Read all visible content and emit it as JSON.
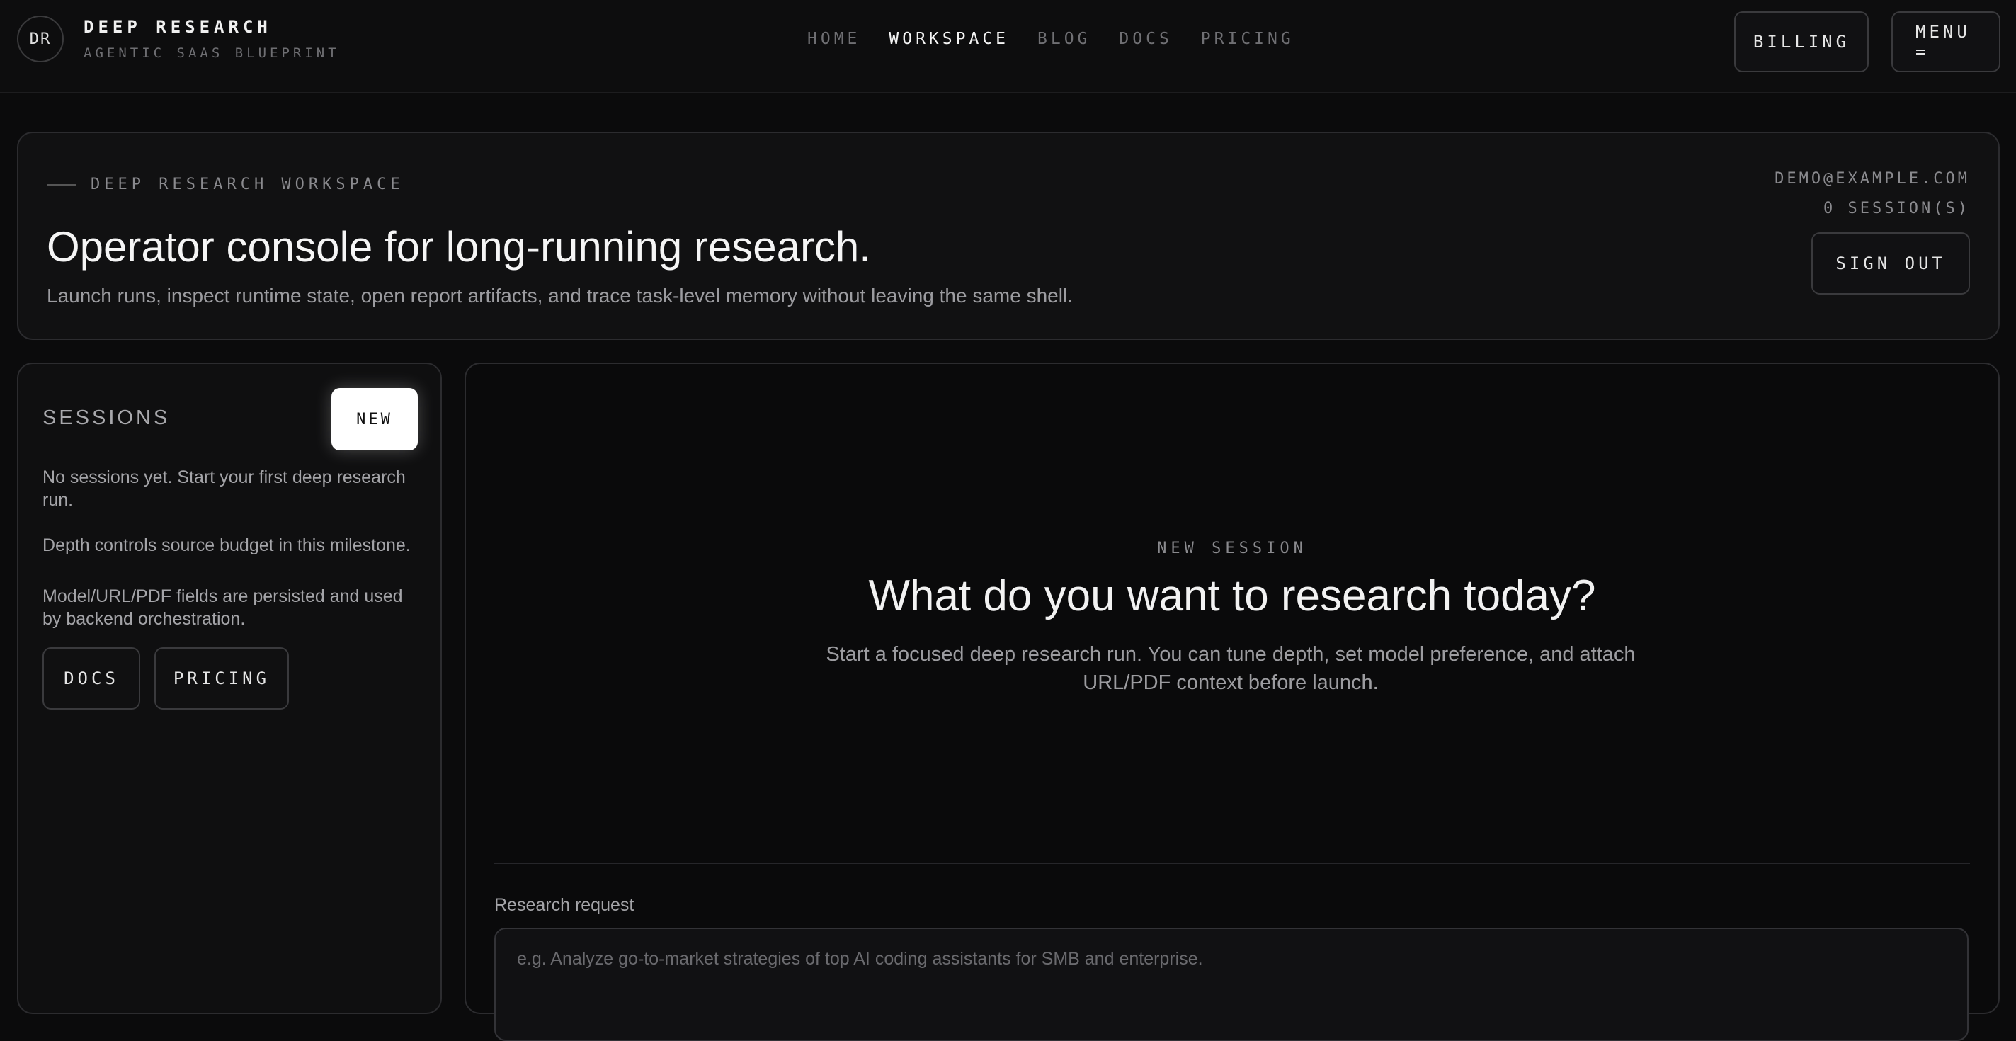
{
  "brand": {
    "logo": "DR",
    "title": "DEEP RESEARCH",
    "subtitle": "AGENTIC SAAS BLUEPRINT"
  },
  "nav": {
    "items": [
      {
        "label": "HOME",
        "active": false
      },
      {
        "label": "WORKSPACE",
        "active": true
      },
      {
        "label": "BLOG",
        "active": false
      },
      {
        "label": "DOCS",
        "active": false
      },
      {
        "label": "PRICING",
        "active": false
      }
    ]
  },
  "top_actions": {
    "billing": "BILLING",
    "menu": "MENU ="
  },
  "hero": {
    "eyebrow": "DEEP RESEARCH WORKSPACE",
    "title": "Operator console for long-running research.",
    "description": "Launch runs, inspect runtime state, open report artifacts, and trace task-level memory without leaving the same shell.",
    "email": "DEMO@EXAMPLE.COM",
    "session_count": "0 SESSION(S)",
    "sign_out": "SIGN OUT"
  },
  "sessions": {
    "title": "SESSIONS",
    "new_button": "NEW",
    "empty_text": "No sessions yet. Start your first deep research run.",
    "note_depth": "Depth controls source budget in this milestone.",
    "note_fields": "Model/URL/PDF fields are persisted and used by backend orchestration.",
    "docs_button": "DOCS",
    "pricing_button": "PRICING"
  },
  "main": {
    "eyebrow": "NEW SESSION",
    "title": "What do you want to research today?",
    "description": "Start a focused deep research run. You can tune depth, set model preference, and attach URL/PDF context before launch.",
    "request_label": "Research request",
    "request_placeholder": "e.g. Analyze go-to-market strategies of top AI coding assistants for SMB and enterprise.",
    "request_value": ""
  },
  "colors": {
    "background": "#0b0b0c",
    "panel_border": "#2c2c2f",
    "accent_button": "#ffffff"
  }
}
